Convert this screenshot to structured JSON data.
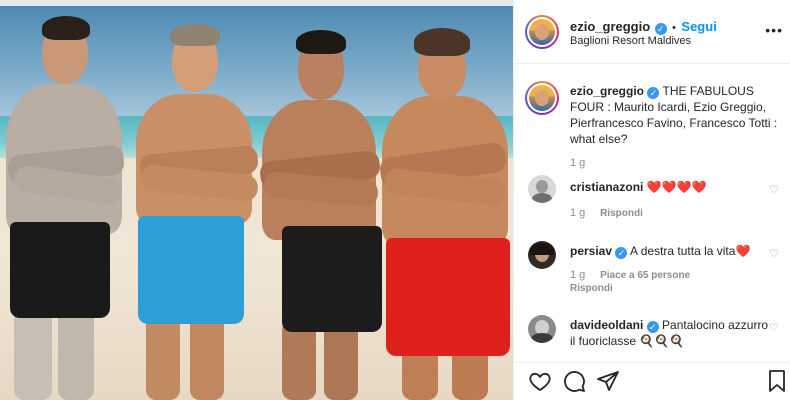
{
  "post": {
    "username": "ezio_greggio",
    "follow_label": "Segui",
    "separator": "•",
    "location": "Baglioni Resort Maldives",
    "more_label": "•••",
    "caption": "THE FABULOUS FOUR : Maurito Icardi, Ezio Greggio, Pierfrancesco Favino, Francesco Totti : what else?",
    "caption_time": "1 g"
  },
  "comments": [
    {
      "username": "cristianazoni",
      "text": "❤️❤️❤️❤️",
      "time": "1 g",
      "reply_label": "Rispondi",
      "verified": false
    },
    {
      "username": "persiav",
      "text": "A destra tutta la vita❤️",
      "time": "1 g",
      "likes_label": "Piace a 65 persone",
      "reply_label": "Rispondi",
      "verified": true
    },
    {
      "username": "davideoldani",
      "text": "Pantalocino azzurro il fuoriclasse 🍳🍳🍳",
      "verified": true
    }
  ],
  "icons": {
    "verified": "verified-badge-icon",
    "like": "heart-icon",
    "comment": "comment-icon",
    "share": "share-icon",
    "save": "bookmark-icon"
  },
  "colors": {
    "accent": "#0095f6",
    "verified": "#3897f0",
    "like_red": "#ed4956",
    "muted": "#8e8e8e",
    "border": "#efefef"
  }
}
